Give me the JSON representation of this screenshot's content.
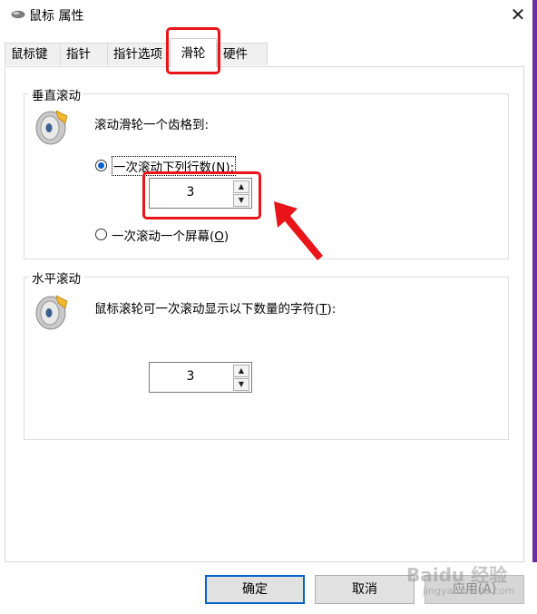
{
  "window": {
    "title": "鼠标 属性",
    "close_glyph": "✕"
  },
  "tabs": [
    {
      "label": "鼠标键"
    },
    {
      "label": "指针"
    },
    {
      "label": "指针选项"
    },
    {
      "label": "滑轮",
      "active": true
    },
    {
      "label": "硬件"
    }
  ],
  "vertical": {
    "title": "垂直滚动",
    "description": "滚动滑轮一个齿格到:",
    "option_lines_prefix": "一次滚动下列行数(",
    "option_lines_key": "N",
    "option_lines_suffix": "):",
    "option_lines_selected": true,
    "lines_value": "3",
    "option_screen_prefix": "一次滚动一个屏幕(",
    "option_screen_key": "O",
    "option_screen_suffix": ")"
  },
  "horizontal": {
    "title": "水平滚动",
    "description_prefix": "鼠标滚轮可一次滚动显示以下数量的字符(",
    "description_key": "T",
    "description_suffix": "):",
    "chars_value": "3"
  },
  "spin_up_glyph": "▲",
  "spin_down_glyph": "▼",
  "buttons": {
    "ok": "确定",
    "cancel": "取消",
    "apply": "应用(A)"
  },
  "watermark": {
    "main": "Baidu 经验",
    "sub": "jingyan.baidu.com"
  },
  "colors": {
    "highlight": "#e8141a",
    "accent": "#0a5fcf"
  },
  "icons": {
    "app": "mouse-icon",
    "wheel": "mouse-wheel-icon",
    "arrow": "red-arrow-annotation"
  }
}
